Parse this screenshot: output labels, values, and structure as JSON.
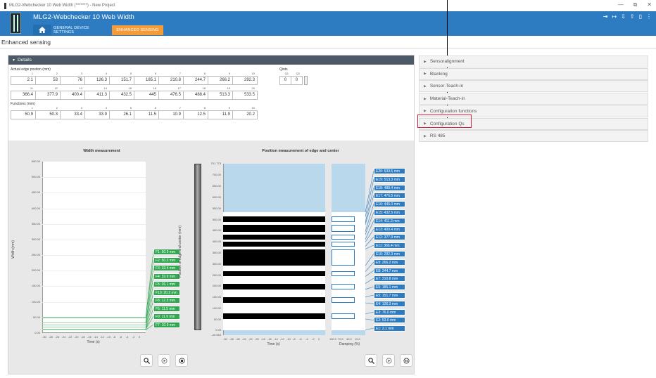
{
  "window": {
    "title": "MLG2-Webchecker 10 Web Width (*******) - New Project",
    "controls": [
      "—",
      "⧉",
      "✕"
    ]
  },
  "app": {
    "title": "MLG2-Webchecker 10 Web Width",
    "tabs": [
      {
        "label": "GENERAL DEVICE SETTINGS",
        "active": false
      },
      {
        "label": "ENHANCED SENSING",
        "active": true
      }
    ],
    "header_icons": [
      "sign-in-icon",
      "sign-out-icon",
      "upload-icon",
      "download-icon",
      "info-icon",
      "more-icon"
    ],
    "accent": "#2d7cc1",
    "active_tab_color": "#f59c3a"
  },
  "page": {
    "label": "Enhanced sensing"
  },
  "details": {
    "header": "Details",
    "actual_edge": {
      "label": "Actual edge positon (mm)",
      "row1": {
        "indices": [
          "1",
          "2",
          "3",
          "4",
          "5",
          "6",
          "7",
          "8",
          "9",
          "10"
        ],
        "values": [
          "2.1",
          "53",
          "76",
          "126.3",
          "151.7",
          "185.1",
          "210.8",
          "244.7",
          "266.2",
          "292.3"
        ]
      },
      "row2": {
        "indices": [
          "11",
          "12",
          "13",
          "14",
          "15",
          "16",
          "17",
          "18",
          "19",
          "20"
        ],
        "values": [
          "366.4",
          "377.9",
          "400.4",
          "411.3",
          "432.5",
          "445",
          "476.5",
          "488.4",
          "513.3",
          "533.5"
        ]
      }
    },
    "qints": {
      "label": "Qints",
      "indices": [
        "Q1",
        "Q2"
      ],
      "values": [
        "0",
        "0"
      ]
    },
    "functions": {
      "label": "Functions (mm)",
      "indices": [
        "1",
        "2",
        "3",
        "4",
        "5",
        "6",
        "7",
        "8",
        "9",
        "10"
      ],
      "values": [
        "50.9",
        "50.3",
        "33.4",
        "33.9",
        "26.1",
        "11.5",
        "10.9",
        "12.5",
        "11.9",
        "20.2"
      ]
    }
  },
  "width_chart": {
    "title": "Width measurement",
    "ylabel": "Width (mm)",
    "xlabel": "Time (s)",
    "yticks": [
      "550.00",
      "500.00",
      "450.00",
      "400.00",
      "350.00",
      "300.00",
      "250.00",
      "200.00",
      "150.00",
      "100.00",
      "50.00",
      "0.00"
    ],
    "xticks": [
      "-30",
      "-28",
      "-26",
      "-24",
      "-22",
      "-20",
      "-18",
      "-16",
      "-14",
      "-12",
      "-10",
      "-8",
      "-6",
      "-4",
      "-2",
      "0"
    ],
    "labels": [
      "F1: 50.9 mm",
      "F2: 50.3 mm",
      "F3: 33.4 mm",
      "F4: 33.9 mm",
      "F5: 26.1 mm",
      "F10: 20.2 mm",
      "F8: 12.5 mm",
      "F6: 11.5 mm",
      "F9: 11.9 mm",
      "F7: 10.9 mm"
    ]
  },
  "position_chart": {
    "title": "Position measurement of edge and center",
    "ylabel": "Position of edge and center (mm)",
    "xlabel": "Time (s)",
    "damping_label": "Damping (%)",
    "yticks": [
      "751.773",
      "700.00",
      "650.00",
      "600.00",
      "550.00",
      "500.00",
      "450.00",
      "400.00",
      "350.00",
      "300.00",
      "250.00",
      "200.00",
      "150.00",
      "100.00",
      "50.00",
      "0.00",
      "-20.654"
    ],
    "xticks": [
      "-30",
      "-28",
      "-26",
      "-24",
      "-22",
      "-20",
      "-18",
      "-16",
      "-14",
      "-12",
      "-10",
      "-8",
      "-6",
      "-4",
      "-2",
      "0"
    ],
    "damping_ticks": [
      "100.0",
      "70.0",
      "40.0",
      "10.0"
    ],
    "labels": [
      "E20: 533.5 mm",
      "E19: 513.3 mm",
      "E18: 488.4 mm",
      "E17: 476.5 mm",
      "E16: 445.0 mm",
      "E15: 432.5 mm",
      "E14: 411.3 mm",
      "E13: 400.4 mm",
      "E12: 377.9 mm",
      "E11: 366.4 mm",
      "E10: 292.3 mm",
      "E9: 266.2 mm",
      "E8: 244.7 mm",
      "E7: 210.8 mm",
      "E6: 185.1 mm",
      "E5: 151.7 mm",
      "E4: 126.3 mm",
      "E3: 76.0 mm",
      "E2: 53.0 mm",
      "E1: 2.1 mm"
    ]
  },
  "accordion": [
    {
      "label": "Sensoralignment"
    },
    {
      "label": "Blanking"
    },
    {
      "label": "Sensor-Teach-in"
    },
    {
      "label": "Material-Teach-in"
    },
    {
      "label": "Configuration functions"
    },
    {
      "label": "Configuration Qs"
    },
    {
      "label": "RS 485"
    }
  ]
}
